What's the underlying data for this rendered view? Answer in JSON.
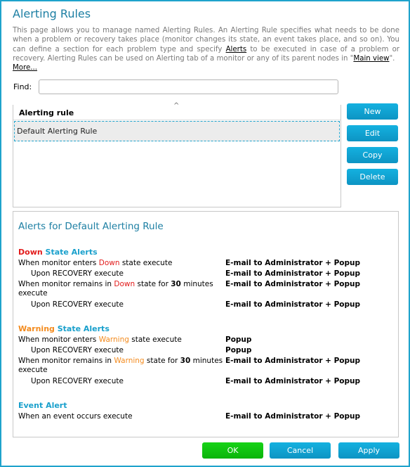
{
  "page": {
    "title": "Alerting Rules",
    "intro": {
      "part1": "This page allows you to manage named Alerting Rules. An Alerting Rule specifies what needs to be done when a problem or recovery takes place (monitor changes its state, an event takes place, and so on). You can define a section for each problem type and specify ",
      "alerts_link": "Alerts",
      "part2": " to be executed in case of a problem or recovery. Alerting Rules can be used on Alerting tab of a monitor or any of its parent nodes in \"",
      "main_view_link": "Main view",
      "part3": "\".",
      "more_link": "More..."
    }
  },
  "find": {
    "label": "Find:",
    "value": "",
    "placeholder": ""
  },
  "rules_table": {
    "sort_indicator": "^",
    "column_header": "Alerting rule",
    "rows": [
      {
        "name": "Default Alerting Rule",
        "selected": true
      }
    ]
  },
  "side_buttons": {
    "new": "New",
    "edit": "Edit",
    "copy": "Copy",
    "delete": "Delete"
  },
  "alerts_panel": {
    "title": "Alerts for Default Alerting Rule",
    "sections": [
      {
        "state_word": "Down",
        "title_suffix": " State Alerts",
        "state_color": "#e21b1b",
        "lines": [
          {
            "prefix": "When monitor enters ",
            "state": "Down",
            "suffix": " state execute",
            "action": "E-mail to Administrator + Popup"
          },
          {
            "text": "Upon RECOVERY execute",
            "action": "E-mail to Administrator + Popup"
          },
          {
            "prefix": "When monitor remains in ",
            "state": "Down",
            "mid": " state for ",
            "duration": "30",
            "unit": " minutes execute",
            "action": "E-mail to Administrator + Popup"
          },
          {
            "text": "Upon RECOVERY execute",
            "action": "E-mail to Administrator + Popup"
          }
        ]
      },
      {
        "state_word": "Warning",
        "title_suffix": " State Alerts",
        "state_color": "#f38b1e",
        "lines": [
          {
            "prefix": "When monitor enters ",
            "state": "Warning",
            "suffix": " state execute",
            "action": "Popup"
          },
          {
            "text": "Upon RECOVERY execute",
            "action": "Popup"
          },
          {
            "prefix": "When monitor remains in ",
            "state": "Warning",
            "mid": " state for ",
            "duration": "30",
            "unit": " minutes execute",
            "action": "E-mail to Administrator + Popup"
          },
          {
            "text": "Upon RECOVERY execute",
            "action": "E-mail to Administrator + Popup"
          }
        ]
      },
      {
        "title": "Event Alert",
        "lines": [
          {
            "text": "When an event occurs execute",
            "action": "E-mail to Administrator + Popup"
          }
        ]
      }
    ]
  },
  "footer": {
    "ok": "OK",
    "cancel": "Cancel",
    "apply": "Apply"
  },
  "colors": {
    "accent": "#1fa3cc",
    "title": "#1d7fa3",
    "down": "#e21b1b",
    "warning": "#f38b1e",
    "ok_button": "#0bb40b"
  }
}
